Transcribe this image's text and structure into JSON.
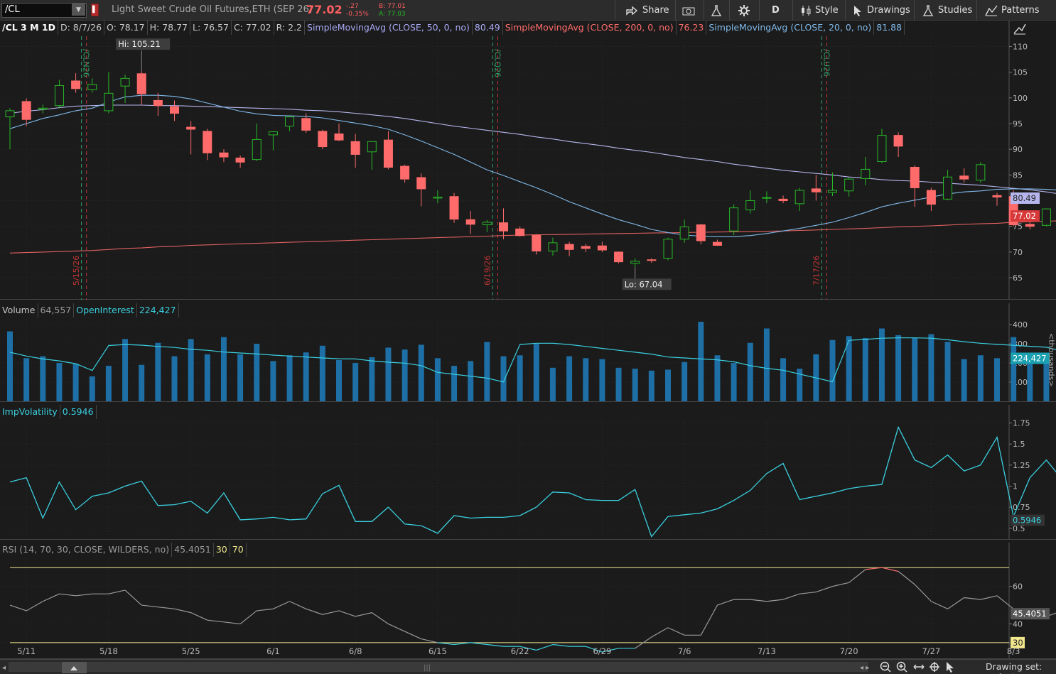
{
  "toolbar": {
    "symbol": "/CL",
    "description": "Light Sweet Crude Oil Futures,ETH (SEP 26)",
    "last": "77.02",
    "change": "-.27",
    "change_pct": "-0.35%",
    "bid": "B: 77.01",
    "ask": "A: 77.03",
    "share": "Share",
    "aggregation": "D",
    "style": "Style",
    "drawings": "Drawings",
    "studies": "Studies",
    "patterns": "Patterns",
    "colors": {
      "up": "#27b727",
      "down": "#ff6b6b",
      "bg": "#1b1b1b"
    }
  },
  "price_header": {
    "label": "/CL 3 M 1D",
    "date": "D: 8/7/26",
    "open": "O: 78.17",
    "high": "H: 78.77",
    "low": "L: 76.57",
    "close": "C: 77.02",
    "range": "R: 2.2",
    "sma50_label": "SimpleMovingAvg (CLOSE, 50, 0, no)",
    "sma50_val": "80.49",
    "sma200_label": "SimpleMovingAvg (CLOSE, 200, 0, no)",
    "sma200_val": "76.23",
    "sma20_label": "SimpleMovingAvg (CLOSE, 20, 0, no)",
    "sma20_val": "81.88"
  },
  "volume_header": {
    "label": "Volume",
    "value": "64,557",
    "oi_label": "OpenInterest",
    "oi_value": "224,427"
  },
  "iv_header": {
    "label": "ImpVolatility",
    "value": "0.5946"
  },
  "rsi_header": {
    "label": "RSI (14, 70, 30, CLOSE, WILDERS, no)",
    "value": "45.4051",
    "os": "30",
    "ob": "70"
  },
  "statusbar": {
    "drawing_set": "Drawing set: Default"
  },
  "chart_data": [
    {
      "type": "candlestick",
      "title": "/CL 3 M 1D",
      "dates": [
        "5/8",
        "5/11",
        "5/12",
        "5/13",
        "5/14",
        "5/15",
        "5/18",
        "5/19",
        "5/20",
        "5/21",
        "5/22",
        "5/25",
        "5/26",
        "5/27",
        "5/28",
        "5/29",
        "6/1",
        "6/2",
        "6/3",
        "6/4",
        "6/5",
        "6/8",
        "6/9",
        "6/10",
        "6/11",
        "6/12",
        "6/15",
        "6/16",
        "6/17",
        "6/18",
        "6/19",
        "6/22",
        "6/23",
        "6/24",
        "6/25",
        "6/26",
        "6/29",
        "6/30",
        "7/1",
        "7/2",
        "7/3",
        "7/6",
        "7/7",
        "7/8",
        "7/9",
        "7/10",
        "7/13",
        "7/14",
        "7/15",
        "7/16",
        "7/17",
        "7/20",
        "7/21",
        "7/22",
        "7/23",
        "7/24",
        "7/27",
        "7/28",
        "7/29",
        "7/30",
        "7/31",
        "8/3",
        "8/4",
        "8/5",
        "8/6",
        "8/7"
      ],
      "ohlc": [
        [
          96.3,
          98.0,
          90.0,
          97.5
        ],
        [
          99.3,
          99.9,
          94.5,
          95.8
        ],
        [
          97.8,
          98.7,
          97.0,
          98.0
        ],
        [
          98.5,
          103.5,
          98.0,
          102.4
        ],
        [
          103.3,
          104.8,
          101.0,
          101.8
        ],
        [
          101.6,
          103.8,
          101.0,
          102.6
        ],
        [
          97.5,
          105.0,
          97.0,
          100.9
        ],
        [
          102.3,
          104.5,
          99.0,
          103.8
        ],
        [
          104.7,
          105.21,
          98.6,
          100.8
        ],
        [
          99.5,
          101.0,
          96.5,
          98.5
        ],
        [
          98.3,
          99.5,
          95.5,
          97.0
        ],
        [
          94.3,
          95.5,
          89.0,
          93.9
        ],
        [
          93.5,
          94.0,
          87.9,
          89.3
        ],
        [
          89.3,
          90.0,
          87.5,
          88.5
        ],
        [
          88.3,
          88.8,
          86.4,
          87.5
        ],
        [
          88.0,
          95.0,
          87.7,
          91.9
        ],
        [
          92.8,
          93.5,
          89.8,
          93.4
        ],
        [
          94.5,
          96.5,
          93.5,
          96.3
        ],
        [
          96.0,
          97.0,
          93.2,
          93.7
        ],
        [
          93.5,
          93.8,
          90.0,
          90.5
        ],
        [
          93.0,
          95.0,
          91.6,
          91.8
        ],
        [
          91.5,
          93.0,
          86.4,
          89.0
        ],
        [
          89.5,
          91.5,
          86.0,
          91.5
        ],
        [
          91.8,
          93.5,
          86.1,
          86.5
        ],
        [
          86.7,
          87.0,
          83.5,
          84.2
        ],
        [
          84.5,
          85.3,
          78.9,
          82.3
        ],
        [
          80.5,
          82.0,
          79.5,
          80.7
        ],
        [
          80.8,
          81.5,
          75.7,
          76.4
        ],
        [
          76.3,
          78.0,
          73.5,
          75.4
        ],
        [
          75.3,
          76.2,
          73.9,
          75.8
        ],
        [
          75.7,
          78.5,
          72.5,
          74.1
        ],
        [
          74.5,
          75.0,
          73.0,
          73.2
        ],
        [
          73.3,
          73.5,
          69.5,
          70.2
        ],
        [
          70.2,
          72.8,
          69.3,
          71.8
        ],
        [
          71.5,
          72.0,
          69.2,
          70.5
        ],
        [
          71.1,
          71.6,
          70.0,
          70.7
        ],
        [
          71.2,
          72.0,
          70.0,
          70.4
        ],
        [
          70.0,
          70.1,
          67.8,
          68.1
        ],
        [
          67.8,
          68.8,
          67.04,
          68.2
        ],
        [
          68.5,
          68.8,
          67.9,
          68.4
        ],
        [
          68.8,
          72.8,
          68.4,
          72.5
        ],
        [
          72.5,
          76.3,
          71.8,
          74.9
        ],
        [
          75.3,
          75.5,
          71.5,
          72.2
        ],
        [
          71.9,
          72.4,
          71.2,
          71.3
        ],
        [
          74.1,
          79.3,
          73.3,
          78.6
        ],
        [
          78.2,
          82.0,
          77.5,
          80.0
        ],
        [
          80.6,
          81.8,
          79.5,
          80.6
        ],
        [
          80.3,
          81.0,
          79.5,
          80.0
        ],
        [
          79.4,
          82.5,
          78.0,
          82.0
        ],
        [
          82.3,
          85.0,
          80.0,
          81.7
        ],
        [
          81.6,
          85.5,
          80.9,
          82.0
        ],
        [
          81.9,
          84.5,
          80.8,
          84.2
        ],
        [
          84.3,
          88.5,
          83.0,
          86.1
        ],
        [
          87.6,
          94.0,
          87.3,
          92.7
        ],
        [
          92.7,
          93.3,
          88.5,
          90.6
        ],
        [
          86.5,
          86.9,
          78.8,
          82.5
        ],
        [
          82.0,
          82.5,
          78.0,
          79.3
        ],
        [
          80.3,
          86.0,
          80.1,
          84.6
        ],
        [
          84.8,
          86.3,
          83.5,
          84.2
        ],
        [
          84.0,
          87.5,
          83.5,
          87.0
        ],
        [
          81.0,
          81.5,
          79.0,
          80.7
        ],
        [
          80.8,
          82.0,
          75.0,
          75.3
        ],
        [
          75.4,
          76.6,
          74.4,
          75.0
        ],
        [
          75.2,
          78.5,
          75.0,
          78.4
        ],
        [
          78.17,
          78.77,
          76.57,
          77.02
        ]
      ],
      "ylim": [
        61,
        112
      ],
      "yticks": [
        65,
        70,
        75,
        80,
        85,
        90,
        95,
        100,
        105,
        110
      ],
      "sma20": [
        94,
        95,
        96,
        96.7,
        97.5,
        98,
        99.2,
        100.2,
        100.5,
        100.5,
        100.3,
        99.8,
        99,
        98.2,
        97.4,
        96.9,
        96.6,
        96.5,
        96.4,
        96.1,
        95.6,
        95.1,
        94.6,
        93.9,
        92.8,
        91.6,
        90.3,
        89,
        87.5,
        86,
        84.9,
        83.7,
        82.5,
        81.2,
        79.8,
        78.6,
        77.4,
        76.3,
        75.4,
        74.4,
        73.8,
        73.3,
        73.1,
        73,
        73,
        73.2,
        73.6,
        74.1,
        74.6,
        75.2,
        75.8,
        76.7,
        77.7,
        78.8,
        79.5,
        80.1,
        80.7,
        81.3,
        81.7,
        81.9,
        82.2,
        82.3,
        82.3,
        82.2,
        82,
        81.9
      ],
      "sma50": [
        97,
        97.4,
        97.7,
        98.1,
        98.4,
        98.5,
        98.6,
        98.6,
        98.6,
        98.5,
        98.5,
        98.4,
        98.3,
        98.2,
        98.1,
        98,
        97.9,
        97.8,
        97.6,
        97.5,
        97.3,
        97,
        96.7,
        96.4,
        96,
        95.5,
        95,
        94.5,
        94.1,
        93.7,
        93.3,
        92.9,
        92.4,
        92,
        91.5,
        91.1,
        90.7,
        90.2,
        89.8,
        89.4,
        88.9,
        88.4,
        88,
        87.6,
        87.1,
        86.7,
        86.3,
        85.9,
        85.6,
        85.3,
        85,
        84.6,
        84.4,
        84.1,
        83.9,
        83.8,
        83.6,
        83.4,
        83.2,
        83,
        82.7,
        82.4,
        82.1,
        81.7,
        81.2,
        80.49
      ],
      "sma200": [
        69.8,
        69.9,
        70,
        70.1,
        70.2,
        70.3,
        70.5,
        70.7,
        70.8,
        71,
        71.1,
        71.3,
        71.4,
        71.5,
        71.6,
        71.7,
        71.8,
        71.9,
        72,
        72.1,
        72.2,
        72.3,
        72.4,
        72.5,
        72.6,
        72.7,
        72.8,
        72.9,
        73,
        73.1,
        73.2,
        73.3,
        73.35,
        73.4,
        73.45,
        73.5,
        73.55,
        73.6,
        73.65,
        73.7,
        73.75,
        73.8,
        73.85,
        73.9,
        73.95,
        74,
        74.05,
        74.1,
        74.2,
        74.3,
        74.4,
        74.5,
        74.6,
        74.75,
        74.9,
        75,
        75.1,
        75.25,
        75.4,
        75.5,
        75.6,
        75.8,
        75.9,
        76,
        76.1,
        76.23
      ],
      "annotations": {
        "high": "Hi: 105.21",
        "low": "Lo: 67.04",
        "roll_labels": [
          "/CLN26",
          "/CLQ26",
          "/CLU26"
        ],
        "expiry_labels": [
          "5/15/26",
          "6/19/26",
          "7/17/26"
        ],
        "sma50_tag": "80.49",
        "close_tag": "77.02"
      }
    },
    {
      "type": "bar",
      "title": "Volume",
      "ylabel": "<thousands>",
      "ylim": [
        0,
        430
      ],
      "yticks": [
        100,
        200,
        300,
        400
      ],
      "values": [
        365,
        225,
        235,
        200,
        195,
        130,
        185,
        325,
        190,
        305,
        235,
        325,
        245,
        335,
        245,
        300,
        210,
        240,
        255,
        290,
        215,
        200,
        230,
        280,
        270,
        295,
        225,
        185,
        210,
        310,
        235,
        240,
        300,
        175,
        235,
        225,
        220,
        175,
        170,
        160,
        165,
        205,
        415,
        240,
        200,
        305,
        380,
        225,
        170,
        245,
        320,
        340,
        330,
        380,
        345,
        330,
        350,
        310,
        220,
        240,
        225,
        335,
        240,
        225,
        220,
        200
      ],
      "open_interest": [
        256,
        236,
        221,
        211,
        196,
        161,
        291,
        296,
        293,
        286,
        281,
        271,
        266,
        257,
        252,
        247,
        241,
        236,
        231,
        226,
        222,
        221,
        211,
        204,
        199,
        186,
        151,
        141,
        131,
        121,
        101,
        296,
        303,
        303,
        296,
        286,
        276,
        266,
        256,
        246,
        231,
        226,
        221,
        216,
        206,
        186,
        172,
        162,
        142,
        122,
        102,
        318,
        323,
        329,
        331,
        331,
        329,
        321,
        311,
        303,
        297,
        292,
        287,
        282,
        261,
        224.427
      ],
      "oi_tag": "224,427"
    },
    {
      "type": "line",
      "title": "ImpVolatility",
      "ylim": [
        0.38,
        1.78
      ],
      "yticks": [
        0.5,
        0.75,
        1,
        1.25,
        1.5,
        1.75
      ],
      "values": [
        1.05,
        1.1,
        0.62,
        1.05,
        0.72,
        0.88,
        0.92,
        1.0,
        1.06,
        0.77,
        0.78,
        0.82,
        0.68,
        0.92,
        0.6,
        0.61,
        0.63,
        0.6,
        0.61,
        0.91,
        1.01,
        0.58,
        0.58,
        0.75,
        0.55,
        0.53,
        0.44,
        0.65,
        0.62,
        0.63,
        0.63,
        0.65,
        0.75,
        0.93,
        0.92,
        0.84,
        0.83,
        0.83,
        0.96,
        0.4,
        0.64,
        0.66,
        0.68,
        0.73,
        0.83,
        0.95,
        1.15,
        1.27,
        0.84,
        0.88,
        0.92,
        0.97,
        1.0,
        1.02,
        1.7,
        1.31,
        1.22,
        1.37,
        1.18,
        1.25,
        1.58,
        0.64,
        1.1,
        1.31,
        1.07,
        0.5946
      ],
      "tag": "0.5946"
    },
    {
      "type": "line",
      "title": "RSI (14, 70, 30, CLOSE, WILDERS, no)",
      "ylim": [
        22,
        75
      ],
      "yticks": [
        30,
        40,
        60
      ],
      "overbought": 70,
      "oversold": 30,
      "values": [
        50,
        47,
        52,
        56,
        55,
        56,
        56,
        58,
        50,
        49,
        48,
        46,
        42,
        41,
        40,
        47,
        48,
        52,
        48,
        45,
        47,
        44,
        46,
        40,
        36,
        32,
        30,
        29,
        30,
        29,
        28,
        28,
        26,
        29,
        28,
        28,
        25,
        27,
        27,
        33,
        38,
        34,
        34,
        50,
        53,
        53,
        52,
        53,
        56,
        57,
        60,
        62,
        69,
        70,
        68,
        61,
        52,
        48,
        54,
        53,
        55,
        48,
        44,
        44,
        47,
        45.4051
      ],
      "tag": "45.4051",
      "os_tag": "30"
    }
  ],
  "x_axis": {
    "labels": [
      "5/11",
      "5/18",
      "5/25",
      "6/1",
      "6/8",
      "6/15",
      "6/22",
      "6/29",
      "7/6",
      "7/13",
      "7/20",
      "7/27",
      "8/3"
    ]
  }
}
